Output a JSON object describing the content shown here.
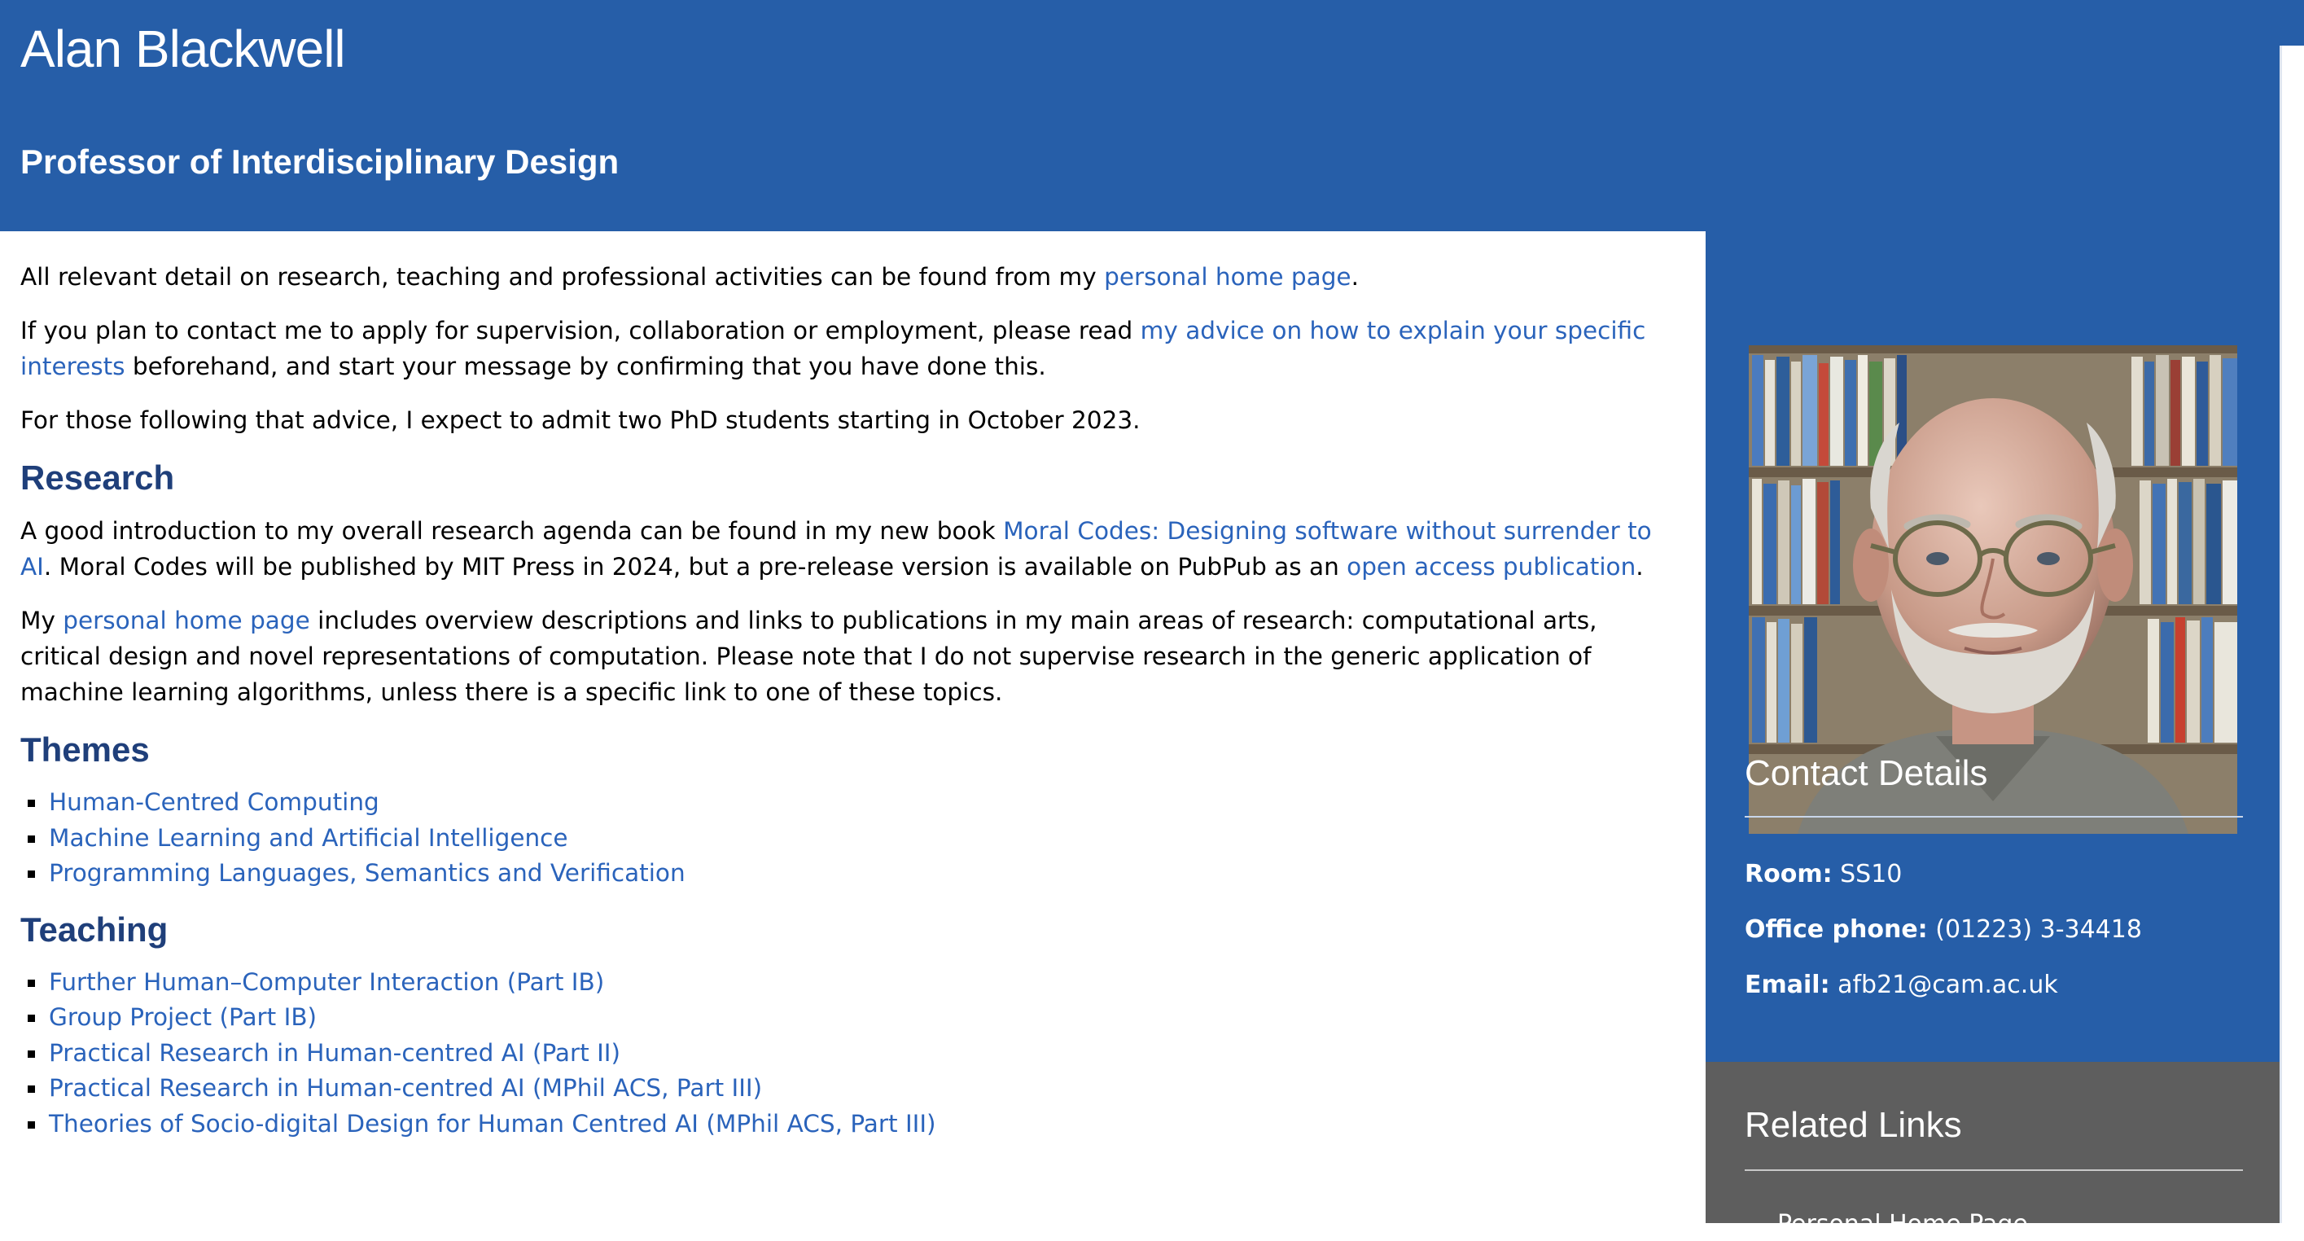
{
  "header": {
    "name": "Alan Blackwell",
    "role": "Professor of Interdisciplinary Design"
  },
  "intro": {
    "p1_before": "All relevant detail on research, teaching and professional activities can be found from my ",
    "p1_link": "personal home page",
    "p1_after": ".",
    "p2_before": "If you plan to contact me to apply for supervision, collaboration or employment, please read ",
    "p2_link": "my advice on how to explain your specific interests",
    "p2_after": " beforehand, and start your message by confirming that you have done this.",
    "p3": "For those following that advice, I expect to admit two PhD students starting in October 2023."
  },
  "research": {
    "heading": "Research",
    "p1_before": "A good introduction to my overall research agenda can be found in my new book ",
    "p1_link": "Moral Codes: Designing software without surrender to AI",
    "p1_mid": ". Moral Codes will be published by MIT Press in 2024, but a pre-release version is available on PubPub as an ",
    "p1_link2": "open access publication",
    "p1_after": ".",
    "p2_before": "My ",
    "p2_link": "personal home page",
    "p2_after": " includes overview descriptions and links to publications in my main areas of research: computational arts, critical design and novel representations of computation. Please note that I do not supervise research in the generic application of machine learning algorithms, unless there is a specific link to one of these topics."
  },
  "themes": {
    "heading": "Themes",
    "items": [
      "Human-Centred Computing",
      "Machine Learning and Artificial Intelligence",
      "Programming Languages, Semantics and Verification"
    ]
  },
  "teaching": {
    "heading": "Teaching",
    "items": [
      "Further Human–Computer Interaction (Part IB)",
      "Group Project (Part IB)",
      "Practical Research in Human-centred AI (Part II)",
      "Practical Research in Human-centred AI (MPhil ACS, Part III)",
      "Theories of Socio-digital Design for Human Centred AI (MPhil ACS, Part III)"
    ]
  },
  "contact": {
    "title": "Contact Details",
    "room_label": "Room:",
    "room_value": "SS10",
    "phone_label": "Office phone:",
    "phone_value": "(01223) 3-34418",
    "email_label": "Email:",
    "email_value": "afb21@cam.ac.uk"
  },
  "related": {
    "title": "Related Links",
    "first_item": "Personal Home Page"
  },
  "colors": {
    "brand_blue": "#265ea8",
    "link": "#2a63bb",
    "heading": "#1f3f7a",
    "related_bg": "#5e5e5e"
  }
}
